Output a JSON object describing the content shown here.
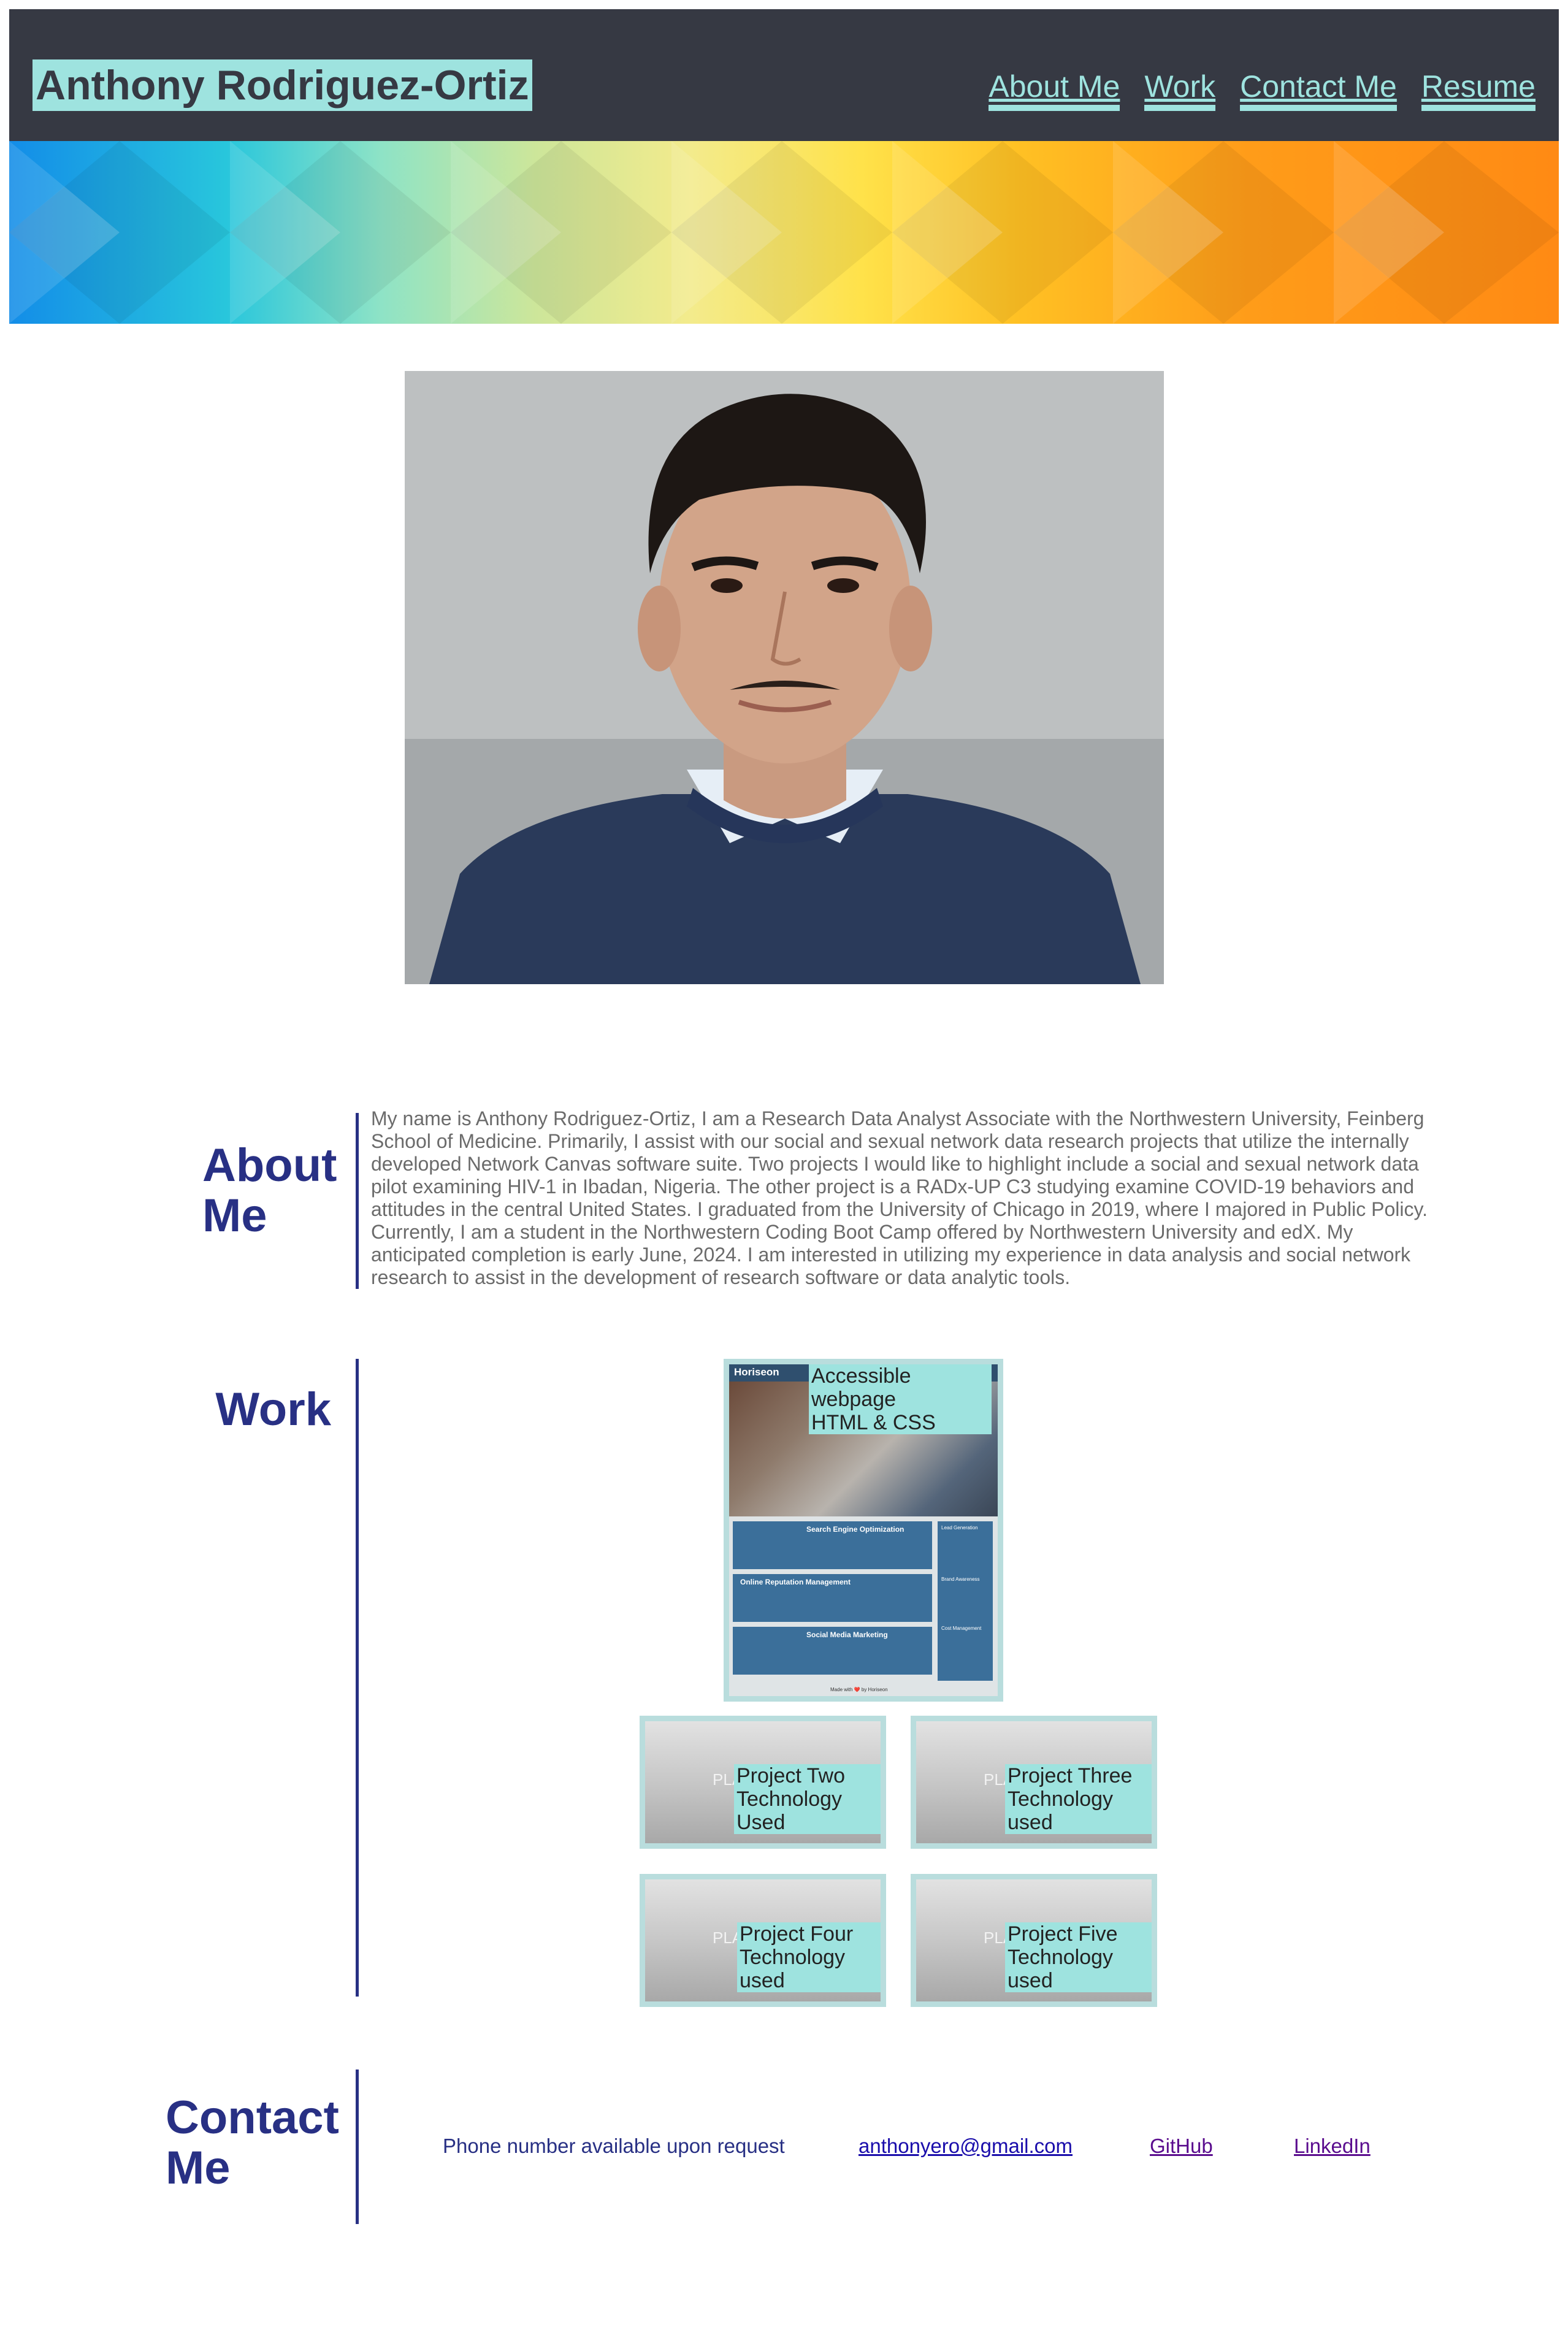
{
  "header": {
    "title": "Anthony Rodriguez-Ortiz",
    "nav": [
      "About Me",
      "Work",
      "Contact Me",
      "Resume"
    ]
  },
  "about": {
    "heading": "About Me",
    "text": "My name is Anthony Rodriguez-Ortiz, I am a Research Data Analyst Associate with the Northwestern University, Feinberg School of Medicine. Primarily, I assist with our social and sexual network data research projects that utilize the internally developed Network Canvas software suite. Two projects I would like to highlight include a social and sexual network data pilot examining HIV-1 in Ibadan, Nigeria. The other project is a RADx-UP C3 studying examine COVID-19 behaviors and attitudes in the central United States. I graduated from the University of Chicago in 2019, where I majored in Public Policy. Currently, I am a student in the Northwestern Coding Boot Camp offered by Northwestern University and edX. My anticipated completion is early June, 2024. I am interested in utilizing my experience in data analysis and social network research to assist in the development of research software or data analytic tools."
  },
  "work": {
    "heading": "Work",
    "featured": {
      "label_line1": "Accessible webpage",
      "label_line2": "HTML & CSS",
      "thumb": {
        "brand": "Horiseon",
        "sections": [
          "Search Engine Optimization",
          "Online Reputation Management",
          "Social Media Marketing"
        ],
        "sidebar": [
          "Lead Generation",
          "Brand Awareness",
          "Cost Management"
        ],
        "footer": "Made with ❤️ by Horiseon"
      }
    },
    "projects": [
      {
        "line1": "Project Two",
        "line2": "Technology Used",
        "ph": "PLA"
      },
      {
        "line1": "Project Three",
        "line2": "Technology used",
        "ph": "PLA"
      },
      {
        "line1": "Project Four",
        "line2": "Technology used",
        "ph": "PLA"
      },
      {
        "line1": "Project Five",
        "line2": "Technology used",
        "ph": "PLA"
      }
    ]
  },
  "contact": {
    "heading": "Contact Me",
    "phone": "Phone number available upon request",
    "email": "anthonyero@gmail.com",
    "github": "GitHub",
    "linkedin": "LinkedIn"
  },
  "colors": {
    "header_bg": "#363943",
    "accent": "#9ee3df",
    "heading": "#283084",
    "body_text": "#6b6b6b",
    "link": "#1a0dab",
    "visited_link": "#5a0c8e"
  }
}
